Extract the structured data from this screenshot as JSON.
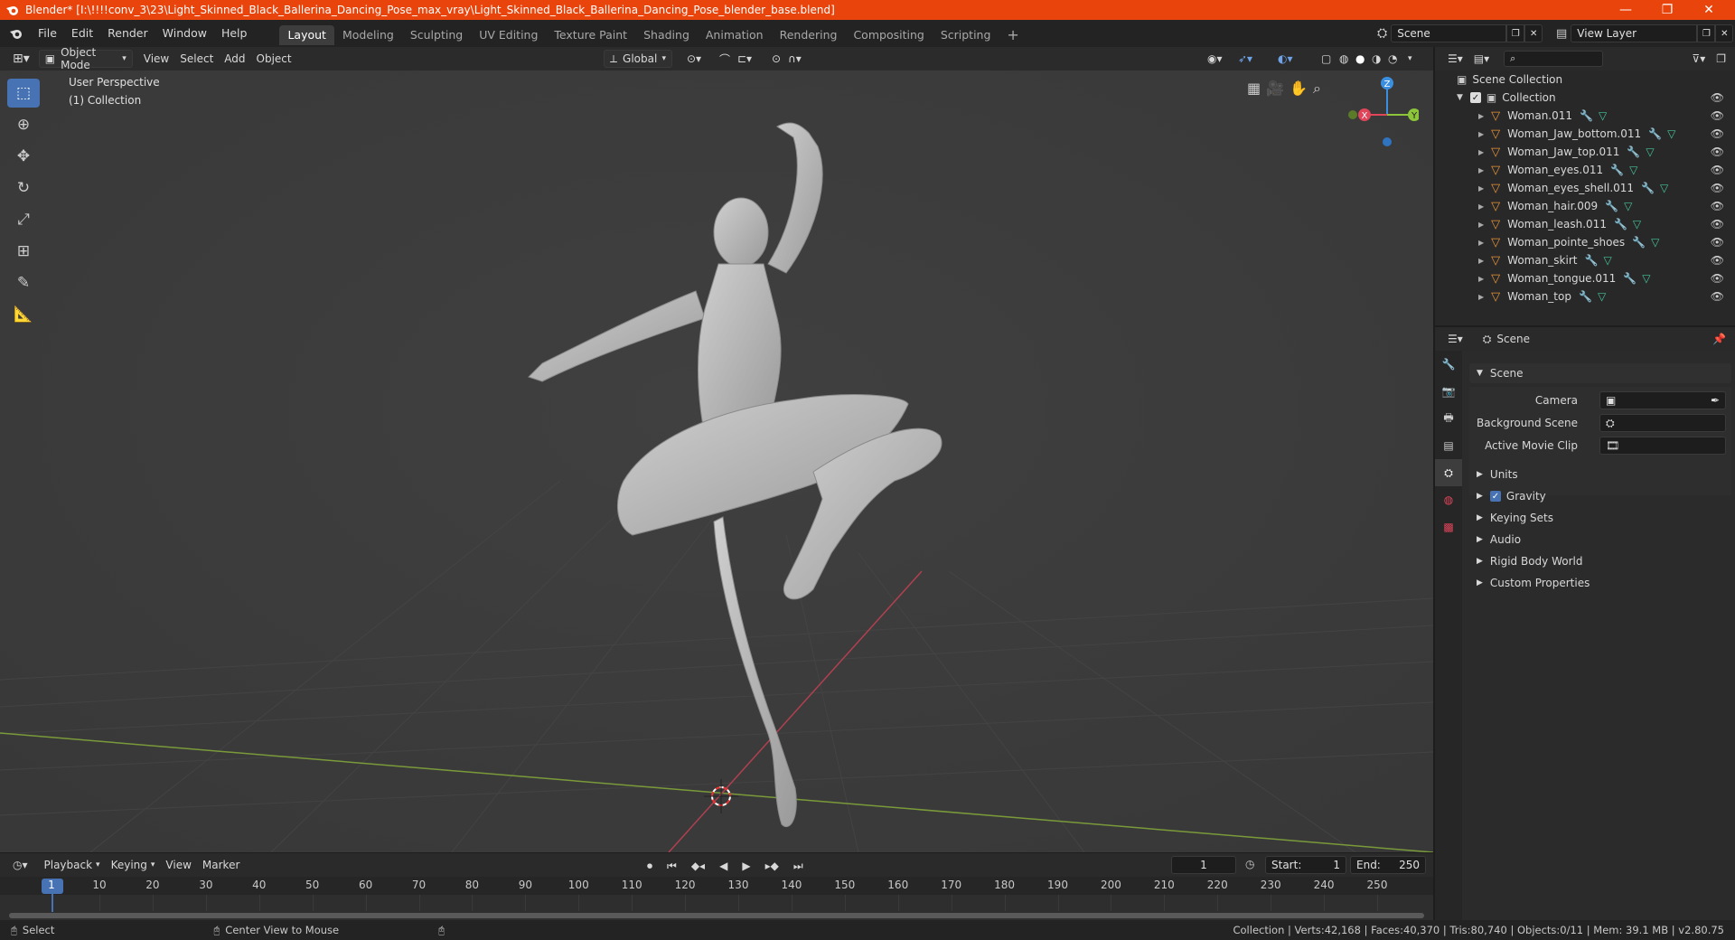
{
  "window": {
    "title": "Blender* [I:\\!!!!conv_3\\23\\Light_Skinned_Black_Ballerina_Dancing_Pose_max_vray\\Light_Skinned_Black_Ballerina_Dancing_Pose_blender_base.blend]",
    "minimize": "—",
    "restore": "❐",
    "close": "✕"
  },
  "menubar": {
    "items": [
      "File",
      "Edit",
      "Render",
      "Window",
      "Help"
    ]
  },
  "workspaces": {
    "tabs": [
      "Layout",
      "Modeling",
      "Sculpting",
      "UV Editing",
      "Texture Paint",
      "Shading",
      "Animation",
      "Rendering",
      "Compositing",
      "Scripting"
    ],
    "add": "+"
  },
  "scene_selector": {
    "value": "Scene"
  },
  "viewlayer_selector": {
    "value": "View Layer"
  },
  "viewport_header": {
    "mode": "Object Mode",
    "menus": [
      "View",
      "Select",
      "Add",
      "Object"
    ],
    "transform_orientation": "Global"
  },
  "viewport": {
    "perspective_label": "User Perspective",
    "collection_label": "(1) Collection",
    "gizmo": {
      "z": "Z",
      "x": "X",
      "y": "Y"
    }
  },
  "outliner": {
    "root": "Scene Collection",
    "collection": "Collection",
    "objects": [
      "Woman.011",
      "Woman_Jaw_bottom.011",
      "Woman_Jaw_top.011",
      "Woman_eyes.011",
      "Woman_eyes_shell.011",
      "Woman_hair.009",
      "Woman_leash.011",
      "Woman_pointe_shoes",
      "Woman_skirt",
      "Woman_tongue.011",
      "Woman_top"
    ]
  },
  "properties": {
    "context": "Scene",
    "panel_title": "Scene",
    "fields": {
      "camera_label": "Camera",
      "background_scene_label": "Background Scene",
      "active_movie_clip_label": "Active Movie Clip"
    },
    "sections": [
      "Units",
      "Gravity",
      "Keying Sets",
      "Audio",
      "Rigid Body World",
      "Custom Properties"
    ],
    "gravity_checked": true
  },
  "timeline": {
    "menus": [
      "Playback",
      "Keying",
      "View",
      "Marker"
    ],
    "current_frame": "1",
    "start_label": "Start:",
    "start_value": "1",
    "end_label": "End:",
    "end_value": "250",
    "ticks": [
      "1",
      "10",
      "20",
      "30",
      "40",
      "50",
      "60",
      "70",
      "80",
      "90",
      "100",
      "110",
      "120",
      "130",
      "140",
      "150",
      "160",
      "170",
      "180",
      "190",
      "200",
      "210",
      "220",
      "230",
      "240",
      "250"
    ]
  },
  "statusbar": {
    "select": "Select",
    "center_view": "Center View to Mouse",
    "stats": "Collection | Verts:42,168 | Faces:40,370 | Tris:80,740 | Objects:0/11 | Mem: 39.1 MB | v2.80.75"
  },
  "colors": {
    "titlebar": "#e8440c",
    "accent_blue": "#4772b3",
    "object_orange": "#e8953a",
    "mesh_green": "#46c49b",
    "x_axis": "#e0455a",
    "y_axis": "#8cc43a",
    "z_axis": "#3b8fe0"
  }
}
